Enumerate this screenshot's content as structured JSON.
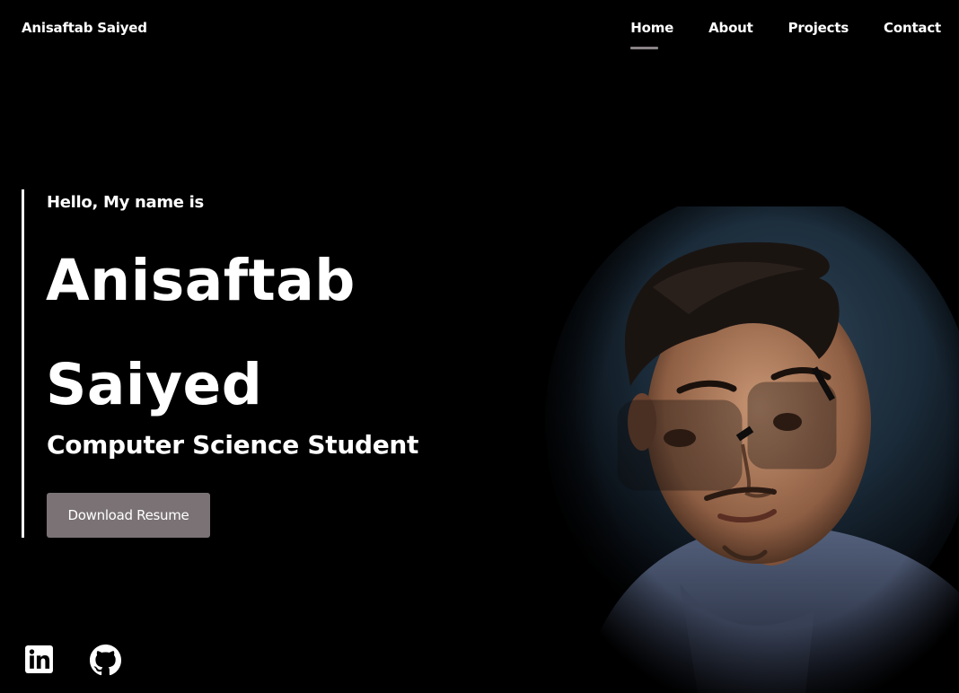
{
  "nav": {
    "brand": "Anisaftab Saiyed",
    "links": [
      {
        "label": "Home",
        "active": true
      },
      {
        "label": "About",
        "active": false
      },
      {
        "label": "Projects",
        "active": false
      },
      {
        "label": "Contact",
        "active": false
      }
    ]
  },
  "hero": {
    "greeting": "Hello, My name is",
    "first_name": "Anisaftab",
    "last_name": "Saiyed",
    "role": "Computer Science Student",
    "resume_label": "Download Resume"
  },
  "social": [
    {
      "icon": "linkedin-icon"
    },
    {
      "icon": "github-icon"
    }
  ],
  "colors": {
    "background": "#000000",
    "text": "#ffffff",
    "button": "#7a7275",
    "nav_underline": "#8a8386"
  }
}
